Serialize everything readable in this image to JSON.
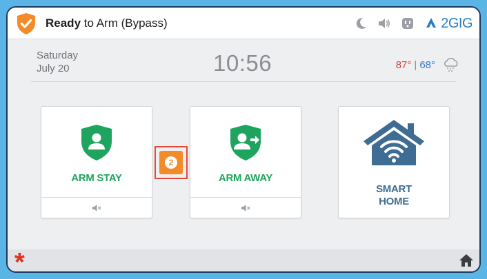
{
  "status": {
    "bold": "Ready",
    "rest": " to Arm (Bypass)"
  },
  "brand": {
    "name": "2GIG"
  },
  "date": {
    "day": "Saturday",
    "month_day": "July 20"
  },
  "clock": {
    "time": "10:56"
  },
  "weather": {
    "high": "87°",
    "separator": "|",
    "low": "68°",
    "condition_icon": "snow-cloud-icon"
  },
  "tiles": {
    "arm_stay": {
      "label": "ARM STAY",
      "icon": "shield-person-icon"
    },
    "arm_away": {
      "label": "ARM AWAY",
      "icon": "shield-person-arrow-icon"
    },
    "smart_home": {
      "label_line1": "SMART",
      "label_line2": "HOME",
      "icon": "house-wifi-icon"
    }
  },
  "bypass": {
    "count": "2"
  },
  "colors": {
    "accent_green": "#1fa45f",
    "accent_blue": "#3e6c93",
    "alert_orange": "#f28b28",
    "highlight_red": "#e34a3a",
    "temp_high": "#d24545",
    "temp_low": "#3878c4"
  },
  "footer": {
    "emergency_symbol": "*"
  }
}
